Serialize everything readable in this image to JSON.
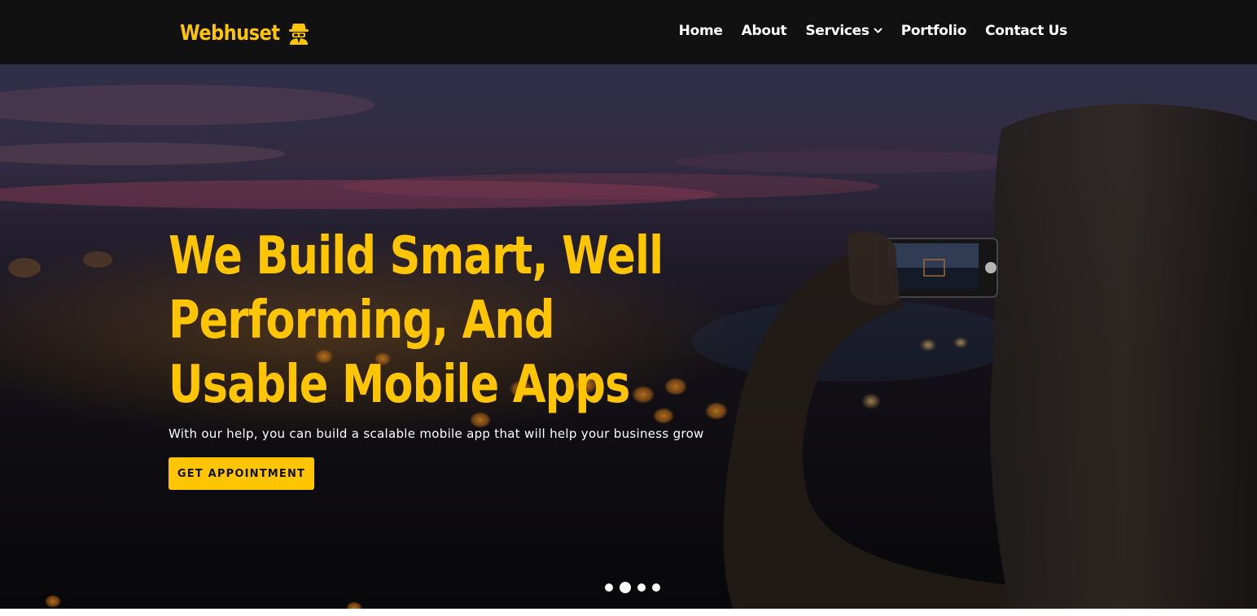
{
  "brand": {
    "name": "Webhuset",
    "icon": "spy-icon",
    "accent_color": "#ffc500"
  },
  "nav": {
    "items": [
      {
        "label": "Home"
      },
      {
        "label": "About"
      },
      {
        "label": "Services",
        "icon": "chevron-down-icon"
      },
      {
        "label": "Portfolio"
      },
      {
        "label": "Contact Us"
      }
    ]
  },
  "hero": {
    "title": "We Build Smart, Well Performing, And Usable Mobile Apps",
    "subtitle": "With our help, you can build a scalable mobile app that will help your business grow",
    "cta_label": "GET APPOINTMENT",
    "background": "night city bokeh, person photographing with smartphone",
    "slides": {
      "count": 4,
      "active": 2
    }
  },
  "colors": {
    "navbar_bg": "#111111",
    "hero_text": "#ffc500",
    "body_text": "#ffffff"
  }
}
